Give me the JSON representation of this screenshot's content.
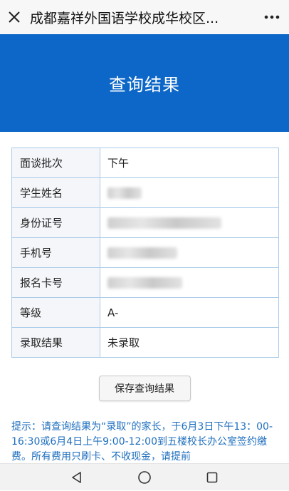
{
  "header": {
    "title": "成都嘉祥外国语学校成华校区...",
    "close_icon": "close-icon",
    "more_icon": "more-icon"
  },
  "banner": {
    "title": "查询结果",
    "background": "#0c67c8"
  },
  "result_table": {
    "rows": [
      {
        "label": "面谈批次",
        "value": "下午"
      },
      {
        "label": "学生姓名",
        "value": ""
      },
      {
        "label": "身份证号",
        "value": ""
      },
      {
        "label": "手机号",
        "value": ""
      },
      {
        "label": "报名卡号",
        "value": ""
      },
      {
        "label": "等级",
        "value": "A-"
      },
      {
        "label": "录取结果",
        "value": "未录取"
      }
    ]
  },
  "actions": {
    "save_label": "保存查询结果"
  },
  "notice": {
    "text": "提示：请查询结果为“录取”的家长，于6月3日下午13：00-16:30或6月4日上午9:00-12:00到五楼校长办公室签约缴费。所有费用只刷卡、不收现金，请提前",
    "color": "#1f6fbf"
  },
  "system_nav": {
    "back_icon": "back-triangle-icon",
    "home_icon": "home-circle-icon",
    "recents_icon": "recents-square-icon"
  }
}
